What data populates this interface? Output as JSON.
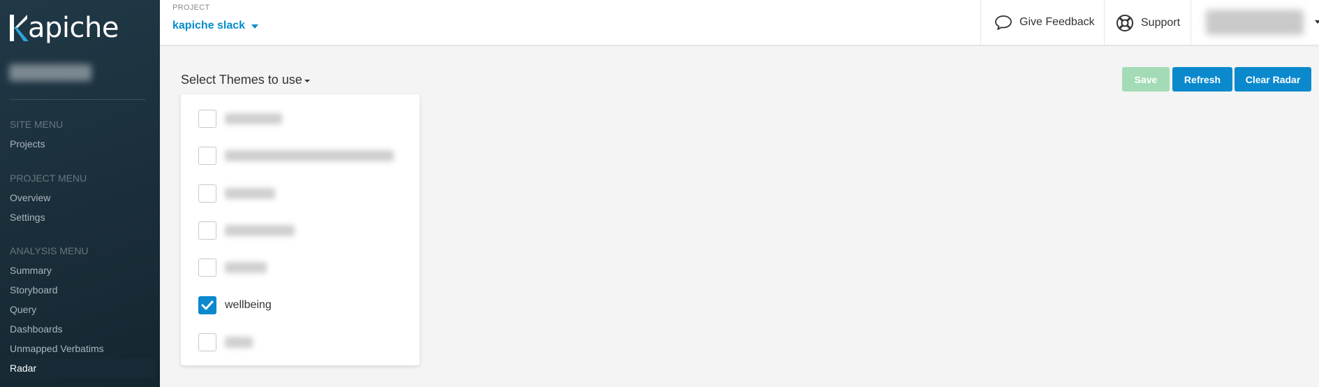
{
  "brand": {
    "logo_text": "apiche"
  },
  "sidebar": {
    "site_menu_header": "SITE MENU",
    "site_items": [
      {
        "label": "Projects"
      }
    ],
    "project_menu_header": "PROJECT MENU",
    "project_items": [
      {
        "label": "Overview"
      },
      {
        "label": "Settings"
      }
    ],
    "analysis_menu_header": "ANALYSIS MENU",
    "analysis_items": [
      {
        "label": "Summary"
      },
      {
        "label": "Storyboard"
      },
      {
        "label": "Query"
      },
      {
        "label": "Dashboards"
      },
      {
        "label": "Unmapped Verbatims"
      },
      {
        "label": "Radar",
        "active": true
      }
    ]
  },
  "header": {
    "project_label": "PROJECT",
    "project_name": "kapiche slack",
    "feedback_label": "Give Feedback",
    "support_label": "Support"
  },
  "main": {
    "themes_select_label": "Select Themes to use",
    "buttons": {
      "save": "Save",
      "refresh": "Refresh",
      "clear": "Clear Radar"
    },
    "themes": [
      {
        "label": "",
        "checked": false,
        "redacted": true
      },
      {
        "label": "",
        "checked": false,
        "redacted": true
      },
      {
        "label": "",
        "checked": false,
        "redacted": true
      },
      {
        "label": "",
        "checked": false,
        "redacted": true
      },
      {
        "label": "",
        "checked": false,
        "redacted": true
      },
      {
        "label": "wellbeing",
        "checked": true,
        "redacted": false
      },
      {
        "label": "",
        "checked": false,
        "redacted": true
      }
    ]
  },
  "colors": {
    "accent": "#0b89cd",
    "save_disabled": "#a3dbb6",
    "sidebar_bg": "#1b2f3b",
    "project_link": "#068ccc"
  },
  "icons": {
    "feedback": "speech-bubble-icon",
    "support": "lifebuoy-icon",
    "checkmark": "checkmark-icon"
  }
}
